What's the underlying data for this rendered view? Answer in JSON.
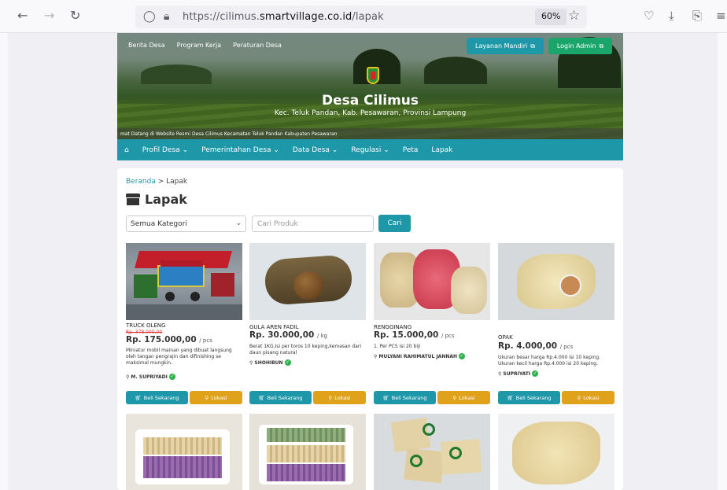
{
  "browser": {
    "url_prefix": "https://cilimus.",
    "url_domain": "smartvillage.co.id",
    "url_path": "/lapak",
    "zoom": "60%"
  },
  "header": {
    "top_links": [
      "Berita Desa",
      "Program Kerja",
      "Peraturan Desa"
    ],
    "layanan_label": "Layanan Mandiri",
    "login_label": "Login Admin",
    "site_title": "Desa Cilimus",
    "site_subtitle": "Kec. Teluk Pandan, Kab. Pesawaran, Provinsi Lampung",
    "marquee": "mat Datang di Website Resmi Desa Cilimus Kecamatan Teluk Pandan Kabupaten Pesawaran"
  },
  "nav": {
    "items": [
      "Profil Desa",
      "Pemerintahan Desa",
      "Data Desa",
      "Regulasi",
      "Peta",
      "Lapak"
    ]
  },
  "content": {
    "breadcrumb_home": "Beranda",
    "breadcrumb_sep": ">",
    "breadcrumb_current": "Lapak",
    "page_title": "Lapak",
    "category_select": "Semua Kategori",
    "search_placeholder": "Cari Produk",
    "search_button": "Cari",
    "buy_label": "Beli Sekarang",
    "loc_label": "Lokasi"
  },
  "products": [
    {
      "name": "TRUCK OLENG",
      "old_price": "Rp. 378.000,00",
      "price": "Rp. 175.000,00",
      "unit": "/ pcs",
      "desc": "Miniatur mobil mainan yang dibuat langsung oleh tangan pengrajin dan difinishing se maksimal mungkin.",
      "seller": "M. SUPRIYADI"
    },
    {
      "name": "GULA AREN FADIL",
      "old_price": "",
      "price": "Rp. 30.000,00",
      "unit": "/ kg",
      "desc": "Berat 1KG,Isi per toros 10 keping,kemasan dari daun pisang natural",
      "seller": "SHOHIBUN"
    },
    {
      "name": "RENGGINANG",
      "old_price": "",
      "price": "Rp. 15.000,00",
      "unit": "/ pcs",
      "desc": "1. Per PCS isi 20 biji",
      "seller": "MULYANI RAHIMATUL JANNAH"
    },
    {
      "name": "OPAK",
      "old_price": "",
      "price": "Rp. 4.000,00",
      "unit": "/ pcs",
      "desc": "Ukuran besar harga Rp.4.000 isi 10 keping. Ukuran kecil harga Rp.4.000 isi 20 keping.",
      "seller": "SUPRIYATI"
    }
  ],
  "colors": {
    "teal": "#1e97a8",
    "gold": "#e0a21a",
    "green": "#2db34a"
  }
}
